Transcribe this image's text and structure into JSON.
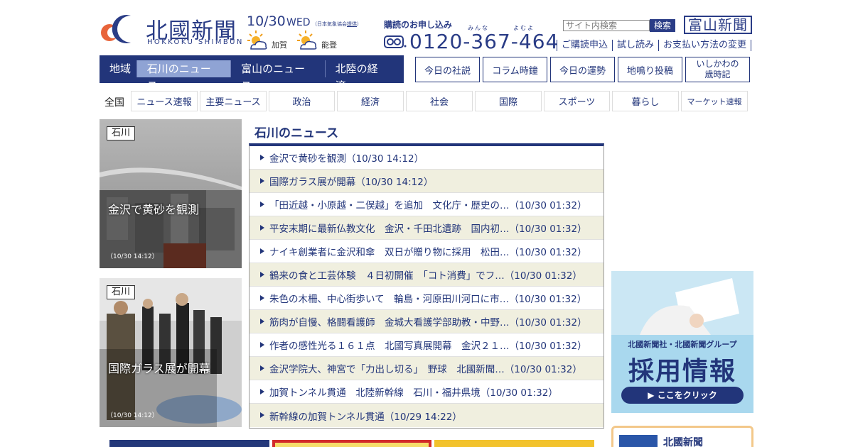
{
  "header": {
    "logo_text": "北國新聞",
    "logo_sub": "HOKKOKU SHIMBUN",
    "date": "10/30",
    "weekday": "WED",
    "weather_note_prefix": "（日本気象協会",
    "weather_note_link": "提供",
    "weather_note_suffix": "）",
    "weather": [
      {
        "label": "加賀",
        "icon": "sun-cloud-icon"
      },
      {
        "label": "能登",
        "icon": "sun-cloud-icon"
      }
    ],
    "subscribe_title": "購読のお申し込み",
    "ruby1": "みんな",
    "ruby2": "よむよ",
    "tel": "0120-367-464",
    "search_placeholder": "サイト内検索",
    "search_button": "検索",
    "toyama_button": "富山新聞",
    "top_links": [
      "ご購読申込",
      "試し読み",
      "お支払い方法の変更"
    ]
  },
  "region_nav": {
    "label": "地域",
    "tabs": [
      "石川のニュース",
      "富山のニュース",
      "北陸の経済"
    ]
  },
  "side_buttons": [
    "今日の社説",
    "コラム時鐘",
    "今日の運勢",
    "地鳴り投稿",
    "いしかわの\n歳時記"
  ],
  "categories": {
    "all": "全国",
    "items": [
      "ニュース速報",
      "主要ニュース",
      "政治",
      "経済",
      "社会",
      "国際",
      "スポーツ",
      "暮らし",
      "マーケット速報"
    ]
  },
  "photos": [
    {
      "badge": "石川",
      "title": "金沢で黄砂を観測",
      "time": "（10/30 14:12）"
    },
    {
      "badge": "石川",
      "title": "国際ガラス展が開幕",
      "time": "（10/30 14:12）"
    }
  ],
  "news": {
    "heading": "石川のニュース",
    "items": [
      "金沢で黄砂を観測（10/30 14:12）",
      "国際ガラス展が開幕（10/30 14:12）",
      "「田近越・小原越・二俣越」を追加　文化庁・歴史の…（10/30 01:32）",
      "平安末期に最新仏教文化　金沢・千田北遺跡　国内初…（10/30 01:32）",
      "ナイキ創業者に金沢和傘　双日が贈り物に採用　松田…（10/30 01:32）",
      "鶴来の食と工芸体験　４日初開催　「コト消費」でフ…（10/30 01:32）",
      "朱色の木柵、中心街歩いて　輪島・河原田川河口に市…（10/30 01:32）",
      "筋肉が自慢、格闘看護師　金城大看護学部助教・中野…（10/30 01:32）",
      "作者の感性光る１６１点　北國写真展開幕　金沢２１…（10/30 01:32）",
      "金沢学院大、神宮で「力出し切る」　野球　北國新聞…（10/30 01:32）",
      "加賀トンネル貫通　北陸新幹線　石川・福井県境（10/30 01:32）",
      "新幹線の加賀トンネル貫通（10/29 14:22）"
    ]
  },
  "ad": {
    "company": "北國新聞社・北國新聞グループ",
    "title": "採用情報",
    "click": "▶ ここをクリック"
  },
  "ad2": {
    "text": "北國新聞"
  },
  "colors": {
    "brand": "#22357a",
    "accent": "#8fa3d4",
    "row_alt": "#f0efdf"
  }
}
